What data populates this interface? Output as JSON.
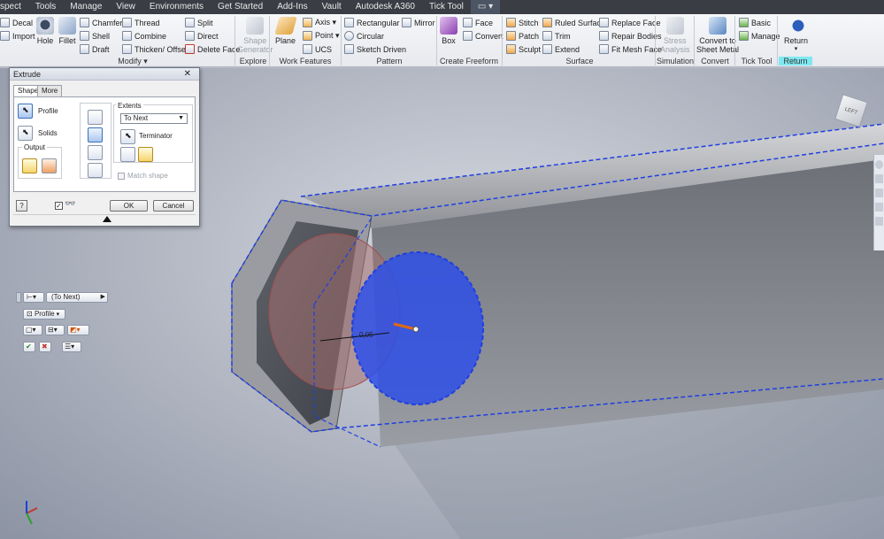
{
  "menu": [
    "spect",
    "Tools",
    "Manage",
    "View",
    "Environments",
    "Get Started",
    "Add-Ins",
    "Vault",
    "Autodesk A360",
    "Tick Tool",
    "▭ ▾"
  ],
  "ribbon": {
    "modify": {
      "decal": "Decal",
      "import": "Import",
      "hole": "Hole",
      "fillet": "Fillet",
      "chamfer": "Chamfer",
      "shell": "Shell",
      "draft": "Draft",
      "thread": "Thread",
      "combine": "Combine",
      "thicken": "Thicken/ Offset",
      "split": "Split",
      "direct": "Direct",
      "delete_face": "Delete Face",
      "group": "Modify ▾"
    },
    "explore": {
      "shape_generator": "Shape\nGenerator",
      "group": "Explore"
    },
    "work": {
      "plane": "Plane",
      "axis": "Axis ▾",
      "point": "Point ▾",
      "ucs": "UCS",
      "group": "Work Features"
    },
    "pattern": {
      "rectangular": "Rectangular",
      "circular": "Circular",
      "sketch_driven": "Sketch Driven",
      "mirror": "Mirror",
      "group": "Pattern"
    },
    "freeform": {
      "box": "Box",
      "face": "Face",
      "convert": "Convert",
      "group": "Create Freeform"
    },
    "surface": {
      "stitch": "Stitch",
      "patch": "Patch",
      "sculpt": "Sculpt",
      "ruled": "Ruled Surface",
      "trim": "Trim",
      "extend": "Extend",
      "replace": "Replace Face",
      "repair": "Repair Bodies",
      "fitmesh": "Fit Mesh Face",
      "group": "Surface"
    },
    "simulation": {
      "stress": "Stress\nAnalysis",
      "group": "Simulation"
    },
    "convert": {
      "sheet_metal": "Convert to\nSheet Metal",
      "group": "Convert"
    },
    "tick": {
      "basic": "Basic",
      "manage": "Manage",
      "group": "Tick Tool"
    },
    "return": {
      "label": "Return",
      "group": "Return"
    }
  },
  "dialog": {
    "title": "Extrude",
    "tabs": [
      "Shape",
      "More"
    ],
    "profile": "Profile",
    "solids": "Solids",
    "output": "Output",
    "extents": "Extents",
    "extents_value": "To Next",
    "terminator": "Terminator",
    "match_shape": "Match shape",
    "ok": "OK",
    "cancel": "Cancel"
  },
  "minitoolbar": {
    "extent": "(To Next)",
    "profile": "Profile"
  },
  "viewport": {
    "dimension": "0,05",
    "viewcube": "LEFT"
  },
  "colors": {
    "menubar": "#3a3d44",
    "selection": "#1f3fe0",
    "return_group": "#7fe8f0"
  }
}
